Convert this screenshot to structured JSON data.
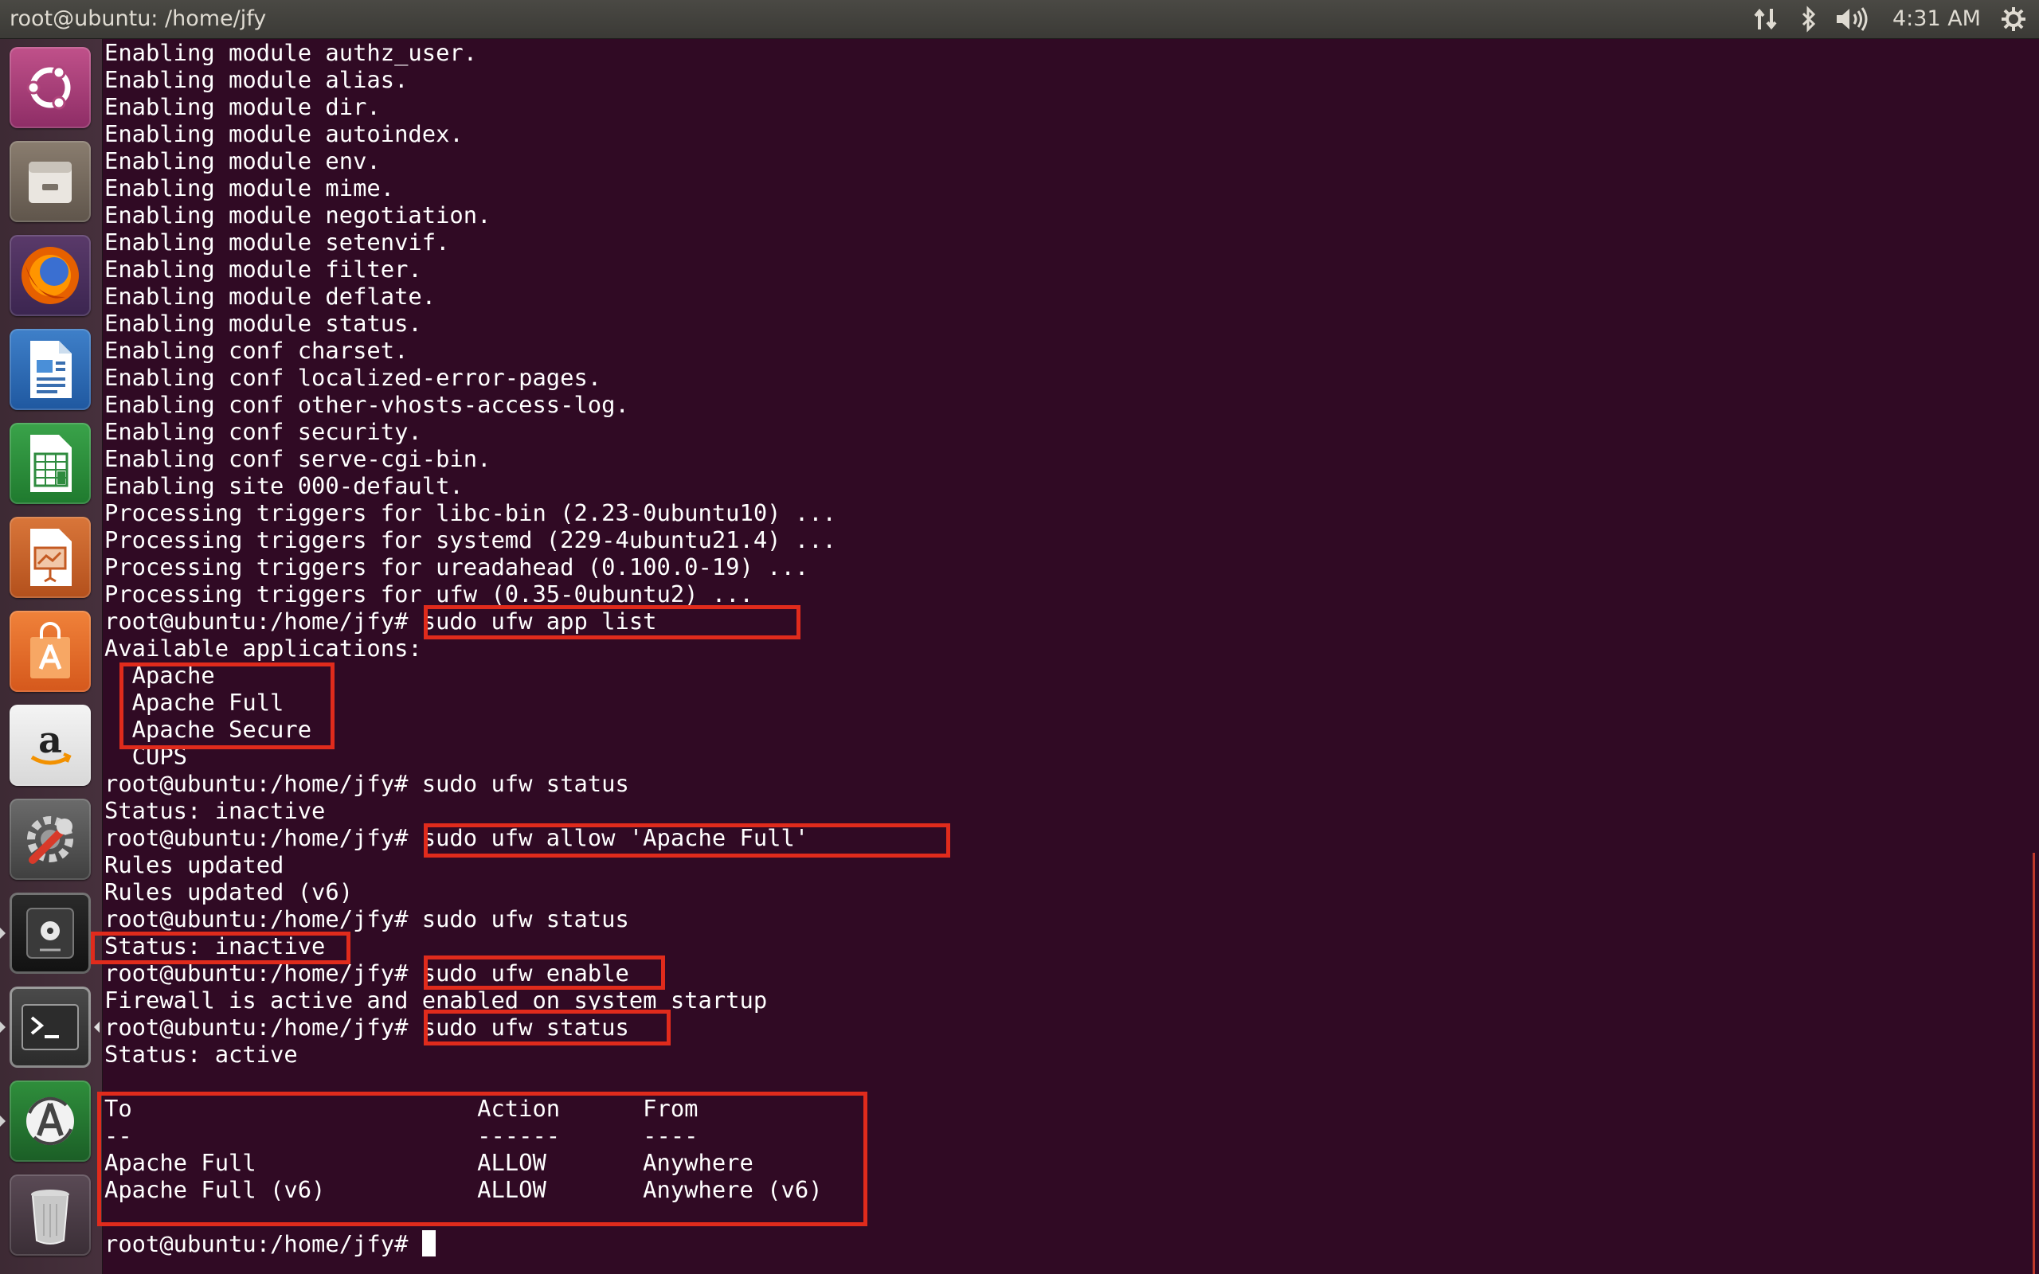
{
  "window": {
    "title": "root@ubuntu: /home/jfy"
  },
  "top_panel": {
    "clock": "4:31 AM"
  },
  "launcher": {
    "items": [
      {
        "name": "ubuntu-dash",
        "icon": "ubuntu-logo-icon"
      },
      {
        "name": "files",
        "icon": "file-cabinet-icon"
      },
      {
        "name": "firefox",
        "icon": "firefox-icon"
      },
      {
        "name": "libreoffice-writer",
        "icon": "document-icon"
      },
      {
        "name": "libreoffice-calc",
        "icon": "spreadsheet-icon"
      },
      {
        "name": "libreoffice-impress",
        "icon": "presentation-icon"
      },
      {
        "name": "ubuntu-software",
        "icon": "shopping-bag-icon"
      },
      {
        "name": "amazon",
        "icon": "amazon-icon"
      },
      {
        "name": "system-settings",
        "icon": "settings-wrench-icon"
      },
      {
        "name": "disks",
        "icon": "safe-disk-icon"
      },
      {
        "name": "terminal",
        "icon": "terminal-icon"
      },
      {
        "name": "software-updater",
        "icon": "updater-icon"
      },
      {
        "name": "trash",
        "icon": "trash-icon"
      }
    ]
  },
  "terminal": {
    "lines": [
      "Enabling module authz_user.",
      "Enabling module alias.",
      "Enabling module dir.",
      "Enabling module autoindex.",
      "Enabling module env.",
      "Enabling module mime.",
      "Enabling module negotiation.",
      "Enabling module setenvif.",
      "Enabling module filter.",
      "Enabling module deflate.",
      "Enabling module status.",
      "Enabling conf charset.",
      "Enabling conf localized-error-pages.",
      "Enabling conf other-vhosts-access-log.",
      "Enabling conf security.",
      "Enabling conf serve-cgi-bin.",
      "Enabling site 000-default.",
      "Processing triggers for libc-bin (2.23-0ubuntu10) ...",
      "Processing triggers for systemd (229-4ubuntu21.4) ...",
      "Processing triggers for ureadahead (0.100.0-19) ...",
      "Processing triggers for ufw (0.35-0ubuntu2) ...",
      "root@ubuntu:/home/jfy# sudo ufw app list",
      "Available applications:",
      "  Apache",
      "  Apache Full",
      "  Apache Secure",
      "  CUPS",
      "root@ubuntu:/home/jfy# sudo ufw status",
      "Status: inactive",
      "root@ubuntu:/home/jfy# sudo ufw allow 'Apache Full'",
      "Rules updated",
      "Rules updated (v6)",
      "root@ubuntu:/home/jfy# sudo ufw status",
      "Status: inactive",
      "root@ubuntu:/home/jfy# sudo ufw enable",
      "Firewall is active and enabled on system startup",
      "root@ubuntu:/home/jfy# sudo ufw status",
      "Status: active",
      "",
      "To                         Action      From",
      "--                         ------      ----",
      "Apache Full                ALLOW       Anywhere",
      "Apache Full (v6)           ALLOW       Anywhere (v6)",
      "",
      "root@ubuntu:/home/jfy# "
    ]
  },
  "accent_colors": {
    "terminal_background": "#300a24",
    "highlight_box": "#e02b1c",
    "panel": "#3b3a36"
  }
}
